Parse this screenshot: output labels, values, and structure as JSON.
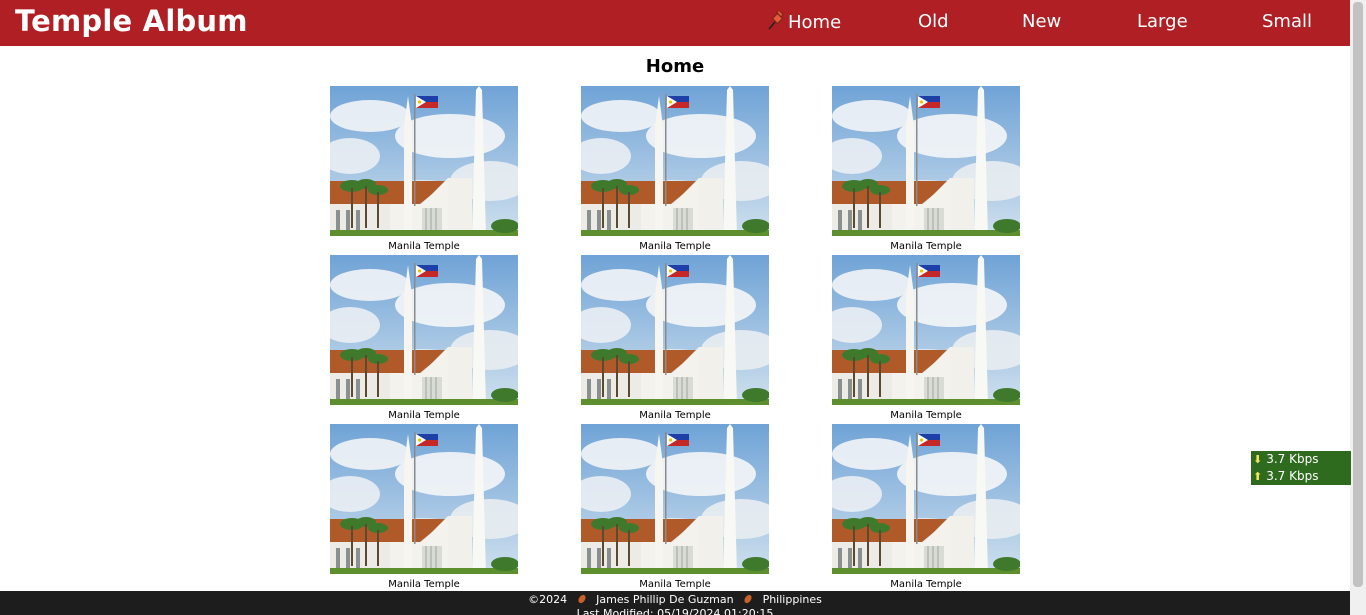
{
  "header": {
    "brand": "Temple Album",
    "nav": [
      {
        "label": "Home",
        "icon": "pushpin-icon",
        "active": true
      },
      {
        "label": "Old"
      },
      {
        "label": "New"
      },
      {
        "label": "Large"
      },
      {
        "label": "Small"
      }
    ]
  },
  "main": {
    "title": "Home",
    "gallery": [
      {
        "caption": "Manila Temple"
      },
      {
        "caption": "Manila Temple"
      },
      {
        "caption": "Manila Temple"
      },
      {
        "caption": "Manila Temple"
      },
      {
        "caption": "Manila Temple"
      },
      {
        "caption": "Manila Temple"
      },
      {
        "caption": "Manila Temple"
      },
      {
        "caption": "Manila Temple"
      },
      {
        "caption": "Manila Temple"
      }
    ]
  },
  "speed_widget": {
    "download": "3.7 Kbps",
    "upload": "3.7 Kbps"
  },
  "footer": {
    "copyright": "©2024",
    "author": "James Phillip De Guzman",
    "country": "Philippines",
    "last_modified": "Last Modified: 05/19/2024 01:20:15"
  },
  "colors": {
    "header_bg": "#b01f24",
    "footer_bg": "#1d1d1d",
    "speed_bg": "#2e6b1e",
    "arrow": "#f4e65a"
  }
}
